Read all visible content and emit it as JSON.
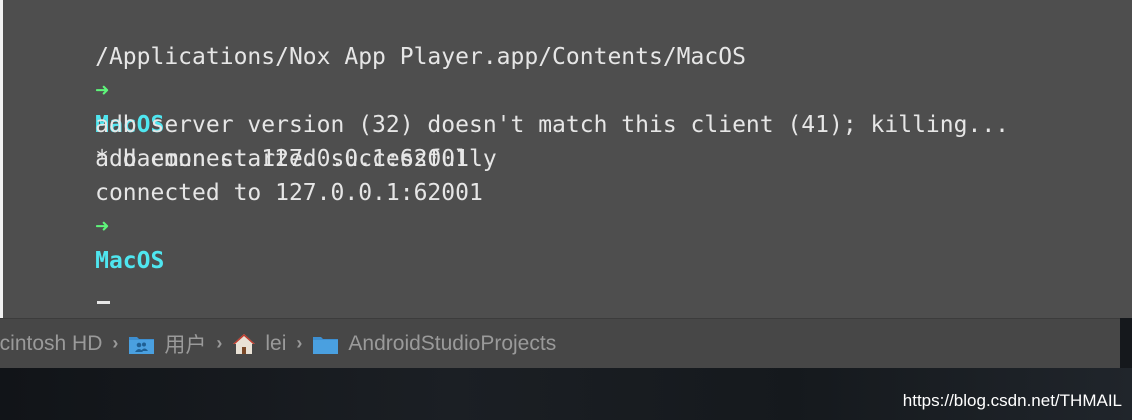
{
  "terminal": {
    "path_line": "/Applications/Nox App Player.app/Contents/MacOS",
    "prompt_arrow": "➜",
    "prompt_dir": "MacOS",
    "command": "adb connect 127.0.0.1:62001",
    "output": [
      "adb server version (32) doesn't match this client (41); killing...",
      "* daemon started successfully",
      "connected to 127.0.0.1:62001"
    ],
    "prompt2_arrow": "➜",
    "prompt2_dir": "MacOS"
  },
  "pathbar": {
    "items": [
      {
        "label": "acintosh HD",
        "icon": "none"
      },
      {
        "label": "用户",
        "icon": "users-folder-icon"
      },
      {
        "label": "lei",
        "icon": "home-icon"
      },
      {
        "label": "AndroidStudioProjects",
        "icon": "folder-icon"
      }
    ],
    "separator": "›"
  },
  "watermark": "https://blog.csdn.net/THMAIL",
  "colors": {
    "terminal_bg": "#4e4e4e",
    "prompt_arrow": "#5ef57a",
    "prompt_dir": "#4fe6f0",
    "text": "#e6e6e6",
    "folder_blue": "#3d8fd1"
  }
}
